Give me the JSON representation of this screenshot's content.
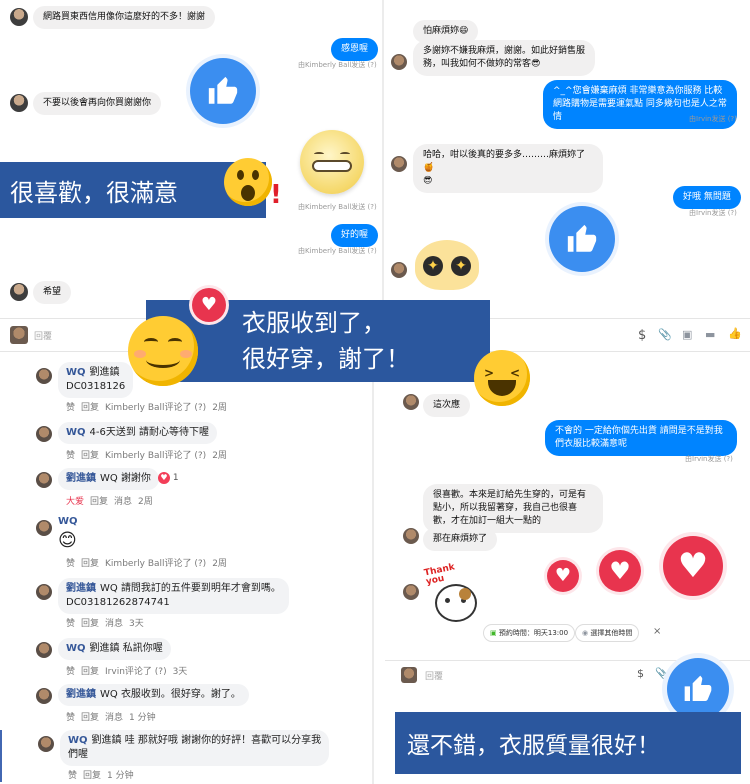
{
  "top_left": {
    "msg1": "網路買東西信用像你這麼好的不多！謝謝",
    "reply1": "感恩喔",
    "meta1": "由Kimberly Ball发送 (?)",
    "msg2": "不要以後會再向你買謝謝你",
    "meta2": "由Kimberly Ball发送 (?)",
    "reply2": "好的喔",
    "meta3": "由Kimberly Ball发送 (?)",
    "msg3": "希望"
  },
  "top_right": {
    "msg1": "怕麻煩妳😄",
    "msg2": "多謝妳不嫌我麻煩，謝謝。如此好銷售服務，叫我如何不做妳的常客😎",
    "reply1": "^_^您會嫌棄麻煩 非常樂意為你服務 比較網路購物是需要運氣點 同多幾句也是人之常情",
    "meta1": "由Irvin发送 (?)",
    "msg3": "哈哈，咁以後真的要多多………麻煩妳了🍯",
    "msg3b": "😎",
    "reply2": "好哦 無問題",
    "meta2": "由Irvin发送 (?)"
  },
  "bottom_right": {
    "msg1": "這次應",
    "reply1": "不會的 一定給你個先出貨 請問是不是對我們衣服比較滿意呢",
    "meta1": "由Irvin发送 (?)",
    "msg2": "很喜歡。本來是訂給先生穿的，可是有點小，所以我留著穿，我自己也很喜歡，才在加訂一組大一點的",
    "msg3": "那在麻煩妳了",
    "sticker_text": "Thank you",
    "chip1": "預約時間：明天13:00",
    "chip2": "選擇其他時間",
    "composer_placeholder": "回覆"
  },
  "composer": {
    "placeholder": "回覆"
  },
  "banners": {
    "b1": "很喜歡，很滿意",
    "b2_line1": "衣服收到了，",
    "b2_line2": "很好穿，謝了！",
    "b3": "還不錯，衣服質量很好！"
  },
  "comments": [
    {
      "name": "WQ",
      "mention": "劉進鎮",
      "text": "WQ 劉進鎮 DC0318126",
      "actions": [
        "赞",
        "回复",
        "Kimberly Ball评论了 (?)",
        "2周"
      ]
    },
    {
      "name": "WQ",
      "text": "4-6天送到 請耐心等待下喔",
      "actions": [
        "赞",
        "回复",
        "Kimberly Ball评论了 (?)",
        "2周"
      ]
    },
    {
      "name": "劉進鎮",
      "text": "WQ 謝謝你",
      "reaction": "1",
      "actions": [
        "大爱",
        "回复",
        "消息",
        "2周"
      ]
    },
    {
      "name": "WQ",
      "text": "😊",
      "actions": [
        "赞",
        "回复",
        "Kimberly Ball评论了 (?)",
        "2周"
      ]
    },
    {
      "name": "劉進鎮",
      "text": "WQ 請問我訂的五件要到明年才會到嗎。",
      "text2": "DC03181262874741",
      "actions": [
        "赞",
        "回复",
        "消息",
        "3天"
      ]
    },
    {
      "name": "WQ",
      "text": "劉進鎮 私訊你喔",
      "actions": [
        "赞",
        "回复",
        "Irvin评论了 (?)",
        "3天"
      ]
    },
    {
      "name": "劉進鎮",
      "text": "WQ 衣服收到。很好穿。謝了。",
      "actions": [
        "赞",
        "回复",
        "消息",
        "1 分钟"
      ]
    },
    {
      "name": "WQ",
      "text": "劉進鎮 哇 那就好哦 謝謝你的好評！喜歡可以分享我",
      "text2": "們喔",
      "actions": [
        "赞",
        "回复",
        "1 分钟"
      ]
    }
  ],
  "colors": {
    "accent": "#0084ff",
    "banner": "#2b579e",
    "thumb": "#3b8ef0",
    "heart": "#e8344e",
    "emoji": "#ffcc33"
  }
}
